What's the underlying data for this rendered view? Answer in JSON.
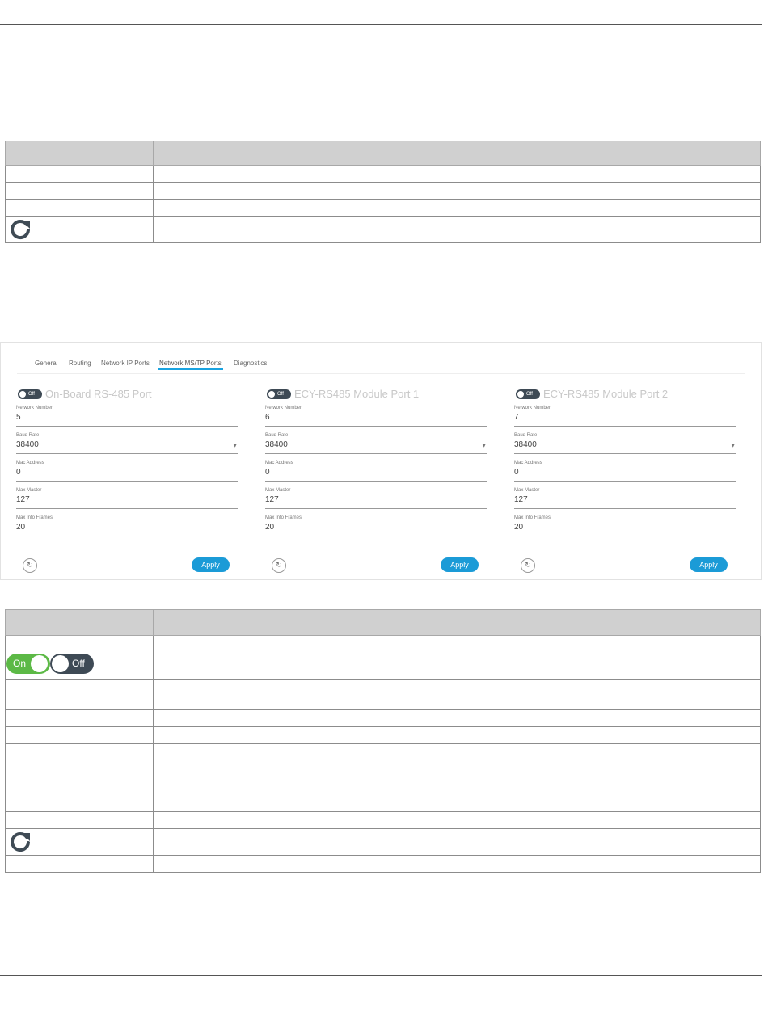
{
  "screenshot": {
    "tabs": [
      "General",
      "Routing",
      "Network IP Ports",
      "Network MS/TP Ports",
      "Diagnostics"
    ],
    "active_tab": "Network MS/TP Ports",
    "cards": [
      {
        "title": "On-Board RS-485 Port",
        "toggle": "Off",
        "fields": [
          {
            "label": "Network Number",
            "value": "5"
          },
          {
            "label": "Baud Rate",
            "value": "38400"
          },
          {
            "label": "Mac Address",
            "value": "0"
          },
          {
            "label": "Max Master",
            "value": "127"
          },
          {
            "label": "Max Info Frames",
            "value": "20"
          }
        ],
        "refresh_glyph": "↻",
        "apply_label": "Apply"
      },
      {
        "title": "ECY-RS485 Module Port 1",
        "toggle": "Off",
        "fields": [
          {
            "label": "Network Number",
            "value": "6"
          },
          {
            "label": "Baud Rate",
            "value": "38400"
          },
          {
            "label": "Mac Address",
            "value": "0"
          },
          {
            "label": "Max Master",
            "value": "127"
          },
          {
            "label": "Max Info Frames",
            "value": "20"
          }
        ],
        "refresh_glyph": "↻",
        "apply_label": "Apply"
      },
      {
        "title": "ECY-RS485 Module Port 2",
        "toggle": "Off",
        "fields": [
          {
            "label": "Network Number",
            "value": "7"
          },
          {
            "label": "Baud Rate",
            "value": "38400"
          },
          {
            "label": "Mac Address",
            "value": "0"
          },
          {
            "label": "Max Master",
            "value": "127"
          },
          {
            "label": "Max Info Frames",
            "value": "20"
          }
        ],
        "refresh_glyph": "↻",
        "apply_label": "Apply"
      }
    ]
  },
  "table2": {
    "toggle_on_label": "On",
    "toggle_off_label": "Off"
  },
  "colors": {
    "toggle_on": "#5cb946",
    "toggle_off": "#3e4a55",
    "apply": "#1b9bd7",
    "refresh_icon": "#3f4b55"
  }
}
